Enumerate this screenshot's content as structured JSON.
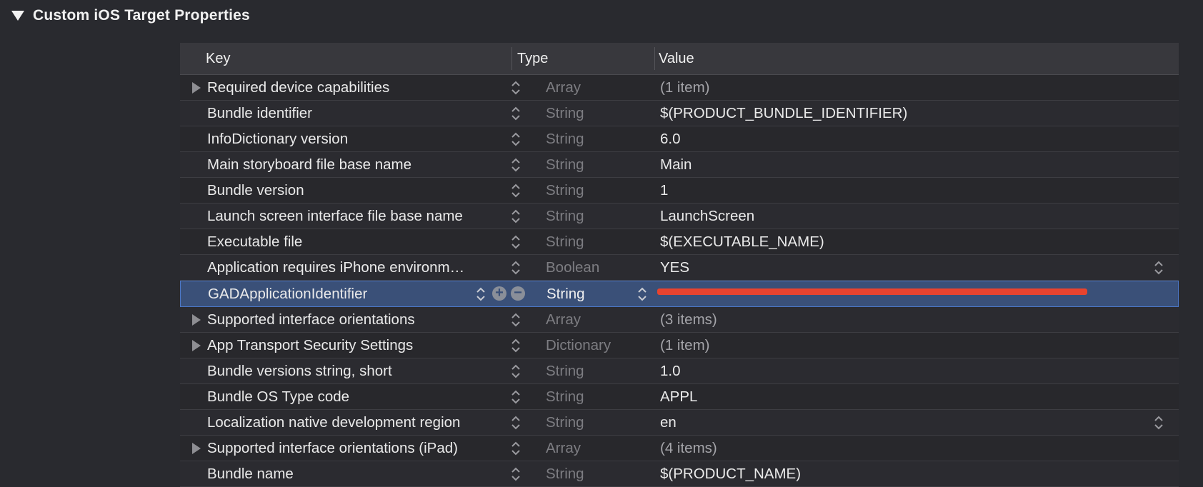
{
  "section": {
    "title": "Custom iOS Target Properties"
  },
  "table": {
    "headers": {
      "key": "Key",
      "type": "Type",
      "value": "Value"
    },
    "rows": [
      {
        "key": "Required device capabilities",
        "type": "Array",
        "value": "(1 item)",
        "expandable": true
      },
      {
        "key": "Bundle identifier",
        "type": "String",
        "value": "$(PRODUCT_BUNDLE_IDENTIFIER)"
      },
      {
        "key": "InfoDictionary version",
        "type": "String",
        "value": "6.0"
      },
      {
        "key": "Main storyboard file base name",
        "type": "String",
        "value": "Main"
      },
      {
        "key": "Bundle version",
        "type": "String",
        "value": "1"
      },
      {
        "key": "Launch screen interface file base name",
        "type": "String",
        "value": "LaunchScreen"
      },
      {
        "key": "Executable file",
        "type": "String",
        "value": "$(EXECUTABLE_NAME)"
      },
      {
        "key": "Application requires iPhone environm…",
        "type": "Boolean",
        "value": "YES",
        "value_popup": true
      },
      {
        "key": "GADApplicationIdentifier",
        "type": "String",
        "value": "",
        "selected": true
      },
      {
        "key": "Supported interface orientations",
        "type": "Array",
        "value": "(3 items)",
        "expandable": true
      },
      {
        "key": "App Transport Security Settings",
        "type": "Dictionary",
        "value": "(1 item)",
        "expandable": true
      },
      {
        "key": "Bundle versions string, short",
        "type": "String",
        "value": "1.0"
      },
      {
        "key": "Bundle OS Type code",
        "type": "String",
        "value": "APPL"
      },
      {
        "key": "Localization native development region",
        "type": "String",
        "value": "en",
        "value_popup": true
      },
      {
        "key": "Supported interface orientations (iPad)",
        "type": "Array",
        "value": "(4 items)",
        "expandable": true
      },
      {
        "key": "Bundle name",
        "type": "String",
        "value": "$(PRODUCT_NAME)"
      }
    ]
  },
  "icons": {
    "disclosure": "disclosure-triangle-down-icon",
    "expander": "disclosure-triangle-right-icon",
    "stepper": "up-down-chevron-icon",
    "add": "plus-circle-icon",
    "remove": "minus-circle-icon"
  },
  "colors": {
    "background": "#292a2f",
    "selection": "#3a5078",
    "redaction": "#e8432e"
  }
}
